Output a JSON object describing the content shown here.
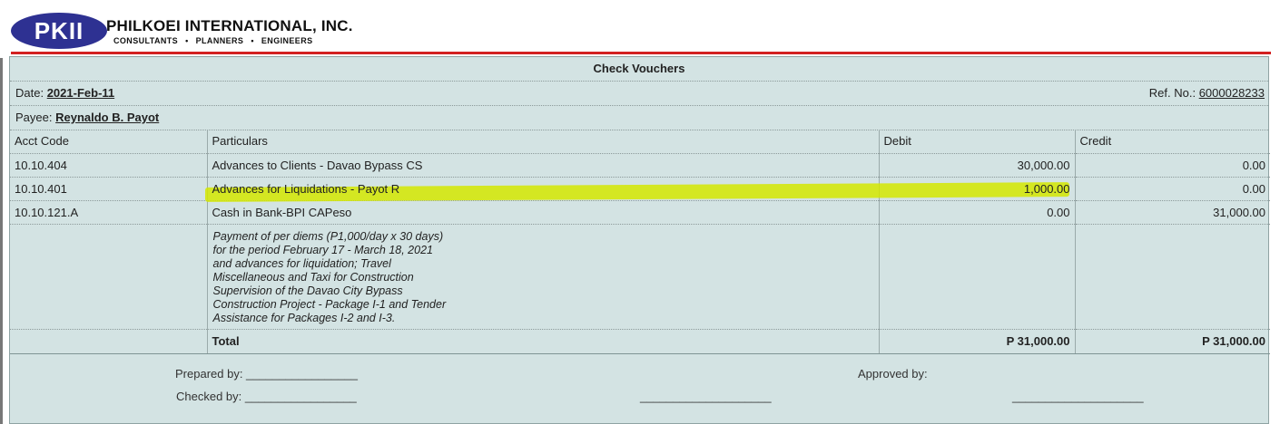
{
  "header": {
    "logo_text": "PKII",
    "company_name": "PHILKOEI INTERNATIONAL, INC.",
    "tagline": [
      "CONSULTANTS",
      "PLANNERS",
      "ENGINEERS"
    ],
    "tagline_separator": "•",
    "colors": {
      "logo_bg": "#2e3192",
      "divider": "#d32121"
    }
  },
  "voucher": {
    "title": "Check Vouchers",
    "date_label": "Date:",
    "date_value": "2021-Feb-11",
    "ref_label": "Ref. No.:",
    "ref_value": "6000028233",
    "payee_label": "Payee:",
    "payee_value": "Reynaldo B. Payot",
    "background": "#d3e3e3",
    "highlight_color": "#d4e800"
  },
  "table": {
    "columns": [
      "Acct Code",
      "Particulars",
      "Debit",
      "Credit"
    ],
    "rows": [
      {
        "code": "10.10.404",
        "particulars": "Advances to Clients - Davao Bypass CS",
        "debit": "30,000.00",
        "credit": "0.00",
        "highlighted": false
      },
      {
        "code": "10.10.401",
        "particulars": "Advances for Liquidations - Payot R",
        "debit": "1,000.00",
        "credit": "0.00",
        "highlighted": true
      },
      {
        "code": "10.10.121.A",
        "particulars": "Cash in Bank-BPI CAPeso",
        "debit": "0.00",
        "credit": "31,000.00",
        "highlighted": false
      }
    ],
    "memo": [
      "Payment of per diems (P1,000/day x 30 days)",
      "for the period February 17 - March 18, 2021",
      "and advances for liquidation; Travel",
      "Miscellaneous and Taxi for Construction",
      "Supervision of the Davao City Bypass",
      "Construction Project - Package I-1 and Tender",
      "Assistance for Packages I-2 and I-3."
    ],
    "total_label": "Total",
    "total_debit": "P 31,000.00",
    "total_credit": "P 31,000.00"
  },
  "signatures": {
    "prepared_by": "Prepared by: _________________",
    "checked_by": "Checked by: _________________",
    "approved_by": "Approved by:",
    "line_1": "____________________",
    "line_2": "____________________"
  }
}
